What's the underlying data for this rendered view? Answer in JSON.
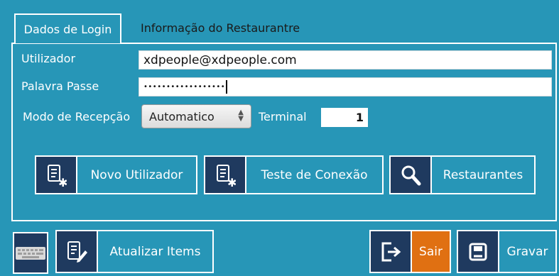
{
  "tabs": {
    "login": "Dados de Login",
    "restaurant": "Informação do Restaurantre"
  },
  "form": {
    "user_label": "Utilizador",
    "user_value": "xdpeople@xdpeople.com",
    "password_label": "Palavra Passe",
    "password_masked": "••••••••••••••••••",
    "mode_label": "Modo de Recepção",
    "mode_value": "Automatico",
    "terminal_label": "Terminal",
    "terminal_value": "1"
  },
  "actions": {
    "new_user": "Novo Utilizador",
    "test_connection": "Teste de Conexão",
    "restaurants": "Restaurantes"
  },
  "footer": {
    "update_items": "Atualizar Items",
    "exit": "Sair",
    "save": "Gravar"
  },
  "colors": {
    "background": "#2796b7",
    "icon_bg": "#1f3a5f",
    "exit_accent": "#e07012"
  }
}
